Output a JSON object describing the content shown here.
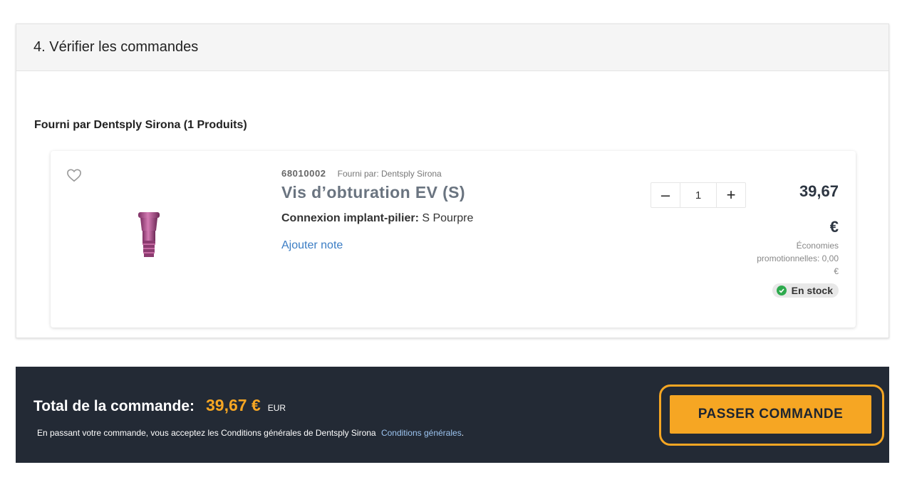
{
  "section": {
    "title": "4. Vérifier les commandes"
  },
  "supplier": {
    "title": "Fourni par Dentsply Sirona (1 Produits)"
  },
  "product": {
    "sku": "68010002",
    "supplied_by": "Fourni par: Dentsply Sirona",
    "name": "Vis d’obturation EV (S)",
    "attr_label": "Connexion implant-pilier:",
    "attr_value": "S Pourpre",
    "add_note": "Ajouter note",
    "quantity": "1",
    "qty_minus": "–",
    "qty_plus": "+",
    "price": "39,67",
    "currency": "€",
    "savings_line1": "Économies",
    "savings_line2": "promotionnelles: 0,00",
    "savings_line3": "€",
    "stock": "En stock",
    "favorite_icon": "heart-outline-icon",
    "image_color": "#b0548f"
  },
  "summary": {
    "total_label": "Total de la commande:",
    "total_amount": "39,67 €",
    "total_unit": "EUR",
    "terms_text": "En passant votre commande, vous acceptez les Conditions générales de Dentsply Sirona",
    "terms_link": "Conditions générales",
    "terms_end": ".",
    "order_button": "PASSER COMMANDE"
  },
  "colors": {
    "accent": "#f6a623",
    "dark_bar": "#232a35",
    "link": "#3b7dc4",
    "stock_ok": "#2eaa4e"
  }
}
